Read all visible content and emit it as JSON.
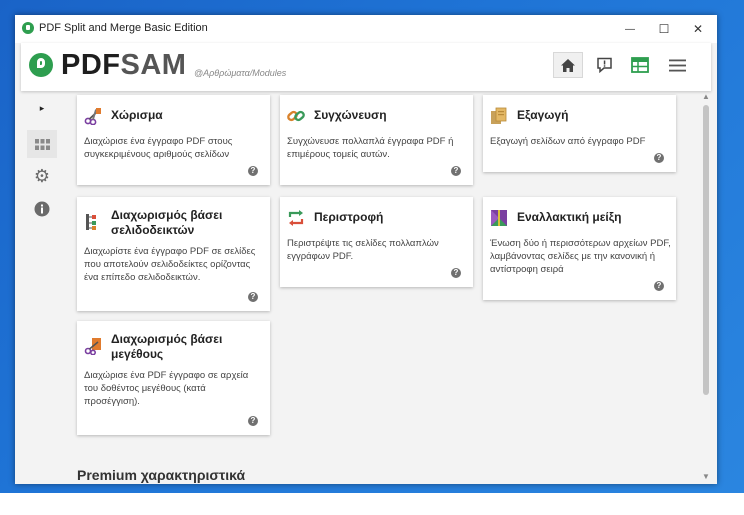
{
  "window": {
    "title": "PDF Split and Merge Basic Edition",
    "controls": {
      "minimize": "—",
      "maximize": "☐",
      "close": "✕"
    }
  },
  "header": {
    "logo_pdf": "PDF",
    "logo_sam": "SAM",
    "subtitle": "@Αρθρώματα/Modules",
    "buttons": [
      {
        "name": "home-icon",
        "active": true
      },
      {
        "name": "feedback-icon",
        "active": false
      },
      {
        "name": "dashboard-icon",
        "active": false
      },
      {
        "name": "menu-icon",
        "active": false
      }
    ]
  },
  "sidebar": {
    "items": [
      {
        "name": "expand-arrow-icon",
        "glyph": "▸"
      },
      {
        "name": "modules-grid-icon",
        "glyph": "▦"
      },
      {
        "name": "settings-gear-icon",
        "glyph": "⚙"
      },
      {
        "name": "info-icon",
        "glyph": "ℹ"
      }
    ]
  },
  "modules": {
    "split": {
      "title": "Χώρισμα",
      "desc1": "Διαχώρισε ένα έγγραφο PDF στους",
      "desc2": "συγκεκριμένους αριθμούς σελίδων"
    },
    "merge": {
      "title": "Συγχώνευση",
      "desc1": "Συγχώνευσε πολλαπλά έγγραφα PDF ή",
      "desc2": "επιμέρους τομείς αυτών."
    },
    "extract": {
      "title": "Εξαγωγή",
      "desc1": "Εξαγωγή σελίδων από έγγραφο PDF"
    },
    "split_bookmarks": {
      "title1": "Διαχωρισμός βάσει",
      "title2": "σελιδοδεικτών",
      "desc1": "Διαχωρίστε ένα έγγραφο PDF σε σελίδες",
      "desc2": "που αποτελούν σελιδοδείκτες ορίζοντας",
      "desc3": "ένα επίπεδο σελιδοδεικτών."
    },
    "rotate": {
      "title": "Περιστροφή",
      "desc1": "Περιστρέψτε τις σελίδες πολλαπλών",
      "desc2": "εγγράφων PDF."
    },
    "alternate_mix": {
      "title": "Εναλλακτική μείξη",
      "desc1": "Ένωση δύο ή περισσότερων αρχείων PDF,",
      "desc2": "λαμβάνοντας σελίδες με την κανονική ή",
      "desc3": "αντίστροφη σειρά"
    },
    "split_size": {
      "title1": "Διαχωρισμός βάσει",
      "title2": "μεγέθους",
      "desc1": "Διαχώρισε ένα PDF έγγραφο σε αρχεία",
      "desc2": "του δοθέντος μεγέθους (κατά",
      "desc3": "προσέγγιση)."
    },
    "help_glyph": "?"
  },
  "premium_heading": "Premium χαρακτηριστικά",
  "colors": {
    "accent_green": "#2e9e4f",
    "desktop_blue": "#1f74d6"
  }
}
